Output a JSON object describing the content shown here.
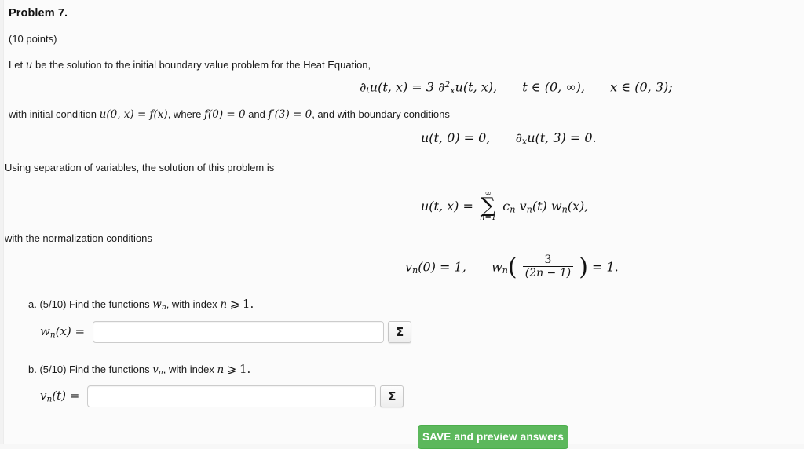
{
  "document": {
    "title": "Problem 7.",
    "points": "(10 points)",
    "intro_before_math": "Let",
    "intro_var": "u",
    "intro_after_math": "be the solution to the initial boundary value problem for the Heat Equation,",
    "pde": {
      "lhs_dt": "∂",
      "lhs_dt_sub": "t",
      "lhs_u": "u(t, x)",
      "equals": "=",
      "coefficient": "3",
      "rhs_dx": "∂",
      "rhs_dx_sub": "x",
      "rhs_dx_sup": "2",
      "rhs_u": "u(t, x),",
      "domain_t": "t ∈ (0, ∞),",
      "domain_x": "x ∈ (0, 3);",
      "full_text": "∂ₜu(t, x) = 3 ∂²ₓu(t, x),   t ∈ (0, ∞),   x ∈ (0, 3);"
    },
    "initial_condition_line": {
      "segment_1": "with initial condition",
      "math_1": "u(0, x) = f(x)",
      "segment_2": ", where",
      "math_2": "f(0) = 0",
      "segment_3": "and",
      "math_3": "f′(3) = 0",
      "segment_4": ", and with boundary conditions",
      "full_text": "with initial condition u(0, x) = f(x), where f(0) = 0 and f′(3) = 0, and with boundary conditions"
    },
    "boundary_conditions": {
      "bc1": "u(t, 0) = 0,",
      "bc2_d": "∂",
      "bc2_sub": "x",
      "bc2_rest": "u(t, 3) = 0.",
      "full_text": "u(t, 0) = 0,   ∂ₓu(t, 3) = 0."
    },
    "separation_text": "Using separation of variables, the solution of this problem is",
    "solution_series": {
      "lhs": "u(t, x)",
      "equals": "=",
      "sum_upper": "∞",
      "sum_symbol": "∑",
      "sum_lower": "n=1",
      "terms_c": "c",
      "terms_c_sub": "n",
      "terms_v": "v",
      "terms_v_sub": "n",
      "terms_v_arg": "(t)",
      "terms_w": "w",
      "terms_w_sub": "n",
      "terms_w_arg": "(x),",
      "full_text": "u(t, x) = ∑(n=1 to ∞) cₙ vₙ(t) wₙ(x),"
    },
    "normalization_text": "with the normalization conditions",
    "normalization": {
      "cond1_v": "v",
      "cond1_sub": "n",
      "cond1_rest": "(0) = 1,",
      "cond2_w": "w",
      "cond2_sub": "n",
      "frac_numerator": "3",
      "frac_denominator": "(2n − 1)",
      "cond2_rest": "= 1.",
      "full_text": "vₙ(0) = 1,   wₙ( 3/(2n − 1) ) = 1."
    },
    "parts": [
      {
        "id": "a",
        "prompt_pre": "a. (5/10) Find the functions",
        "prompt_math": "w",
        "prompt_math_sub": "n",
        "prompt_post": ", with index",
        "index_var": "n",
        "index_rel": "⩾",
        "index_val": "1.",
        "full_text": "a. (5/10) Find the functions wₙ, with index n ⩾ 1.",
        "answer_label_fn": "w",
        "answer_label_sub": "n",
        "answer_label_arg": "(x) =",
        "answer_value": "",
        "answer_placeholder": "",
        "sigma_button": "Σ"
      },
      {
        "id": "b",
        "prompt_pre": "b. (5/10) Find the functions",
        "prompt_math": "v",
        "prompt_math_sub": "n",
        "prompt_post": ", with index",
        "index_var": "n",
        "index_rel": "⩾",
        "index_val": "1.",
        "full_text": "b. (5/10) Find the functions vₙ, with index n ⩾ 1.",
        "answer_label_fn": "v",
        "answer_label_sub": "n",
        "answer_label_arg": "(t) =",
        "answer_value": "",
        "answer_placeholder": "",
        "sigma_button": "Σ"
      }
    ],
    "save_button": "SAVE and preview answers",
    "colors": {
      "save_button_background": "#5cb85c",
      "save_button_border": "#4cae4c",
      "save_button_text": "#ffffff",
      "page_background": "#fbfbfb",
      "input_border": "#cccccc",
      "text": "#1a1a1a"
    }
  }
}
